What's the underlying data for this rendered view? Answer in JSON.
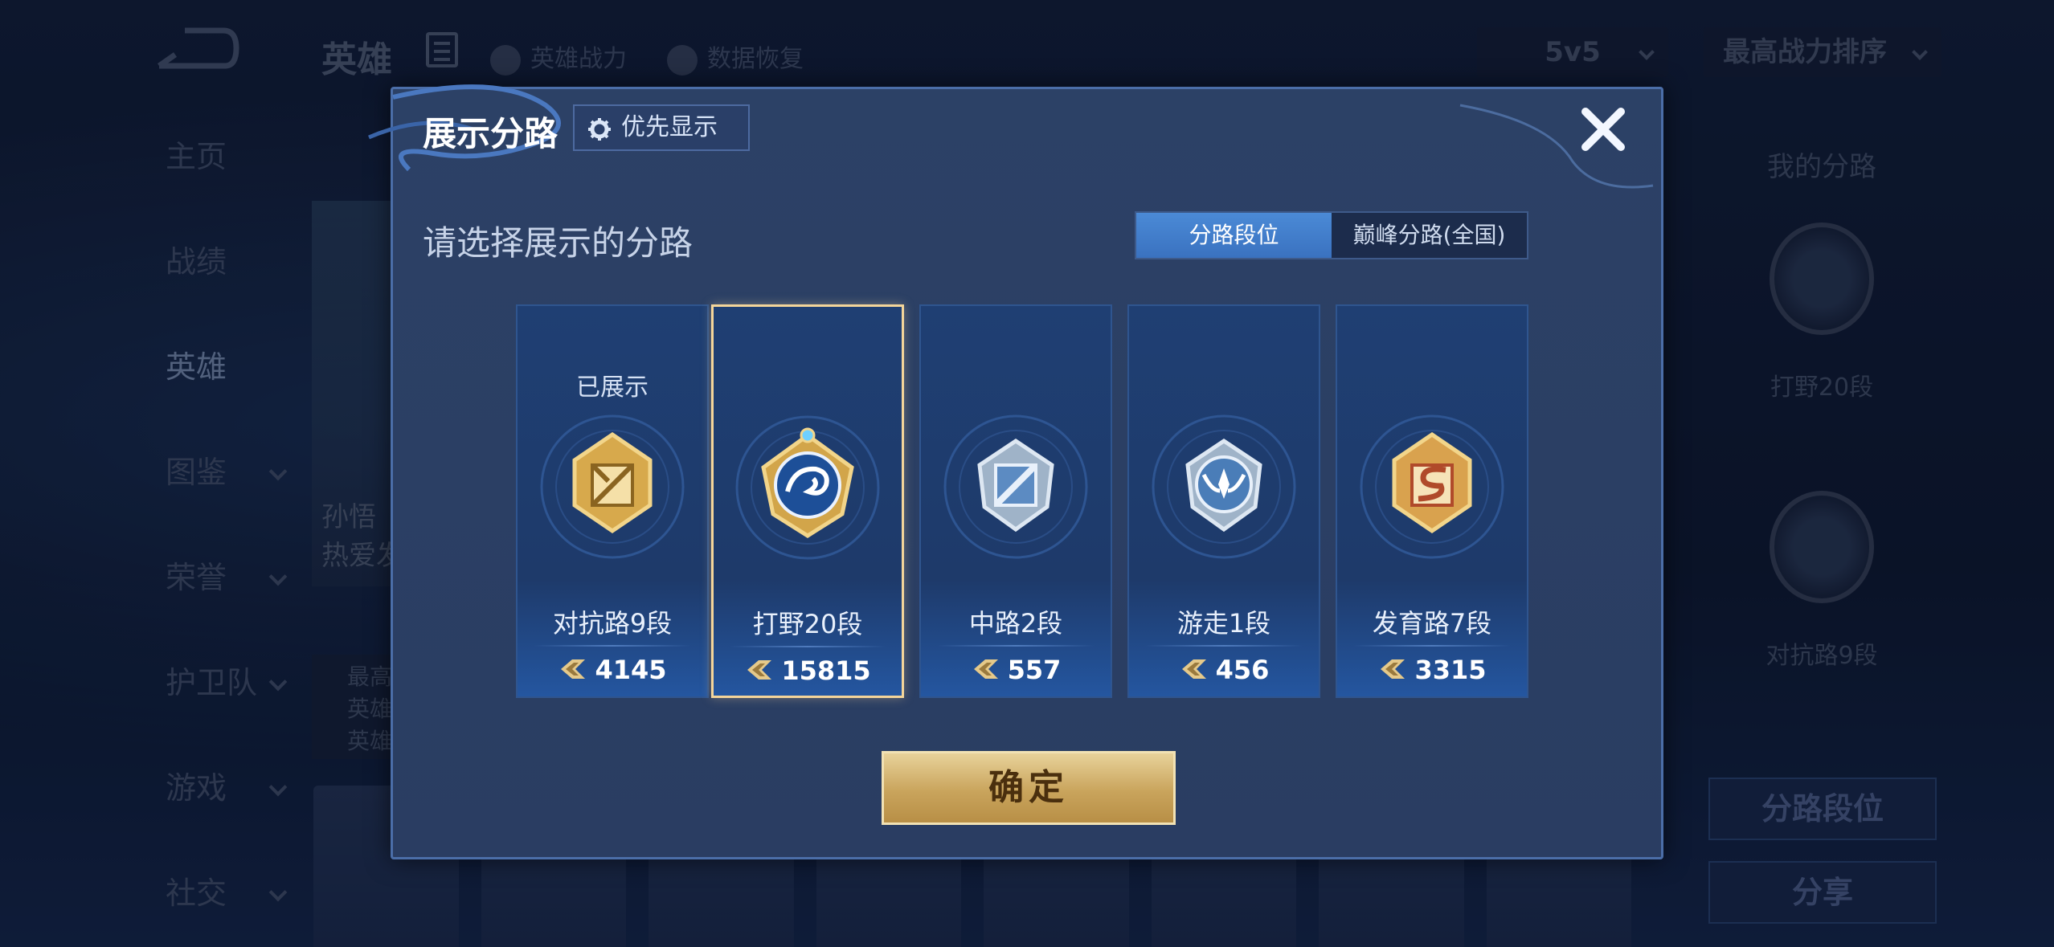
{
  "background": {
    "top_title": "英雄",
    "top_links": [
      "英雄战力",
      "数据恢复"
    ],
    "mode_select": "5v5",
    "sort_select": "最高战力排序",
    "nav": [
      "主页",
      "战绩",
      "英雄",
      "图鉴",
      "荣誉",
      "护卫队",
      "游戏",
      "社交"
    ],
    "nav_active": "英雄",
    "hero_card_text": [
      "孙悟",
      "热爱发"
    ],
    "hero_info": [
      "最高",
      "英雄",
      "英雄"
    ],
    "right_panel": {
      "title": "我的分路",
      "label1": "打野20段",
      "label2": "对抗路9段",
      "btn_primary": "分路段位",
      "btn_share": "分享"
    }
  },
  "modal": {
    "title": "展示分路",
    "priority_button": "优先显示",
    "section_title": "请选择展示的分路",
    "tabs": [
      {
        "label": "分路段位",
        "active": true
      },
      {
        "label": "巅峰分路(全国)",
        "active": false
      }
    ],
    "cards": [
      {
        "name": "对抗路9段",
        "score": "4145",
        "shown_label": "已展示",
        "icon": "clash-lane-gold-badge-icon",
        "selected": false
      },
      {
        "name": "打野20段",
        "score": "15815",
        "shown_label": "",
        "icon": "jungle-dragon-badge-icon",
        "selected": true
      },
      {
        "name": "中路2段",
        "score": "557",
        "shown_label": "",
        "icon": "mid-lane-silver-badge-icon",
        "selected": false
      },
      {
        "name": "游走1段",
        "score": "456",
        "shown_label": "",
        "icon": "roam-silver-badge-icon",
        "selected": false
      },
      {
        "name": "发育路7段",
        "score": "3315",
        "shown_label": "",
        "icon": "farm-lane-gold-badge-icon",
        "selected": false
      }
    ],
    "confirm_button": "确定"
  },
  "colors": {
    "modal_bg": "#2c4166",
    "tab_active": "#4b8ad6",
    "selected_border": "#f4d59a",
    "confirm_gold": "#c9a45c"
  }
}
